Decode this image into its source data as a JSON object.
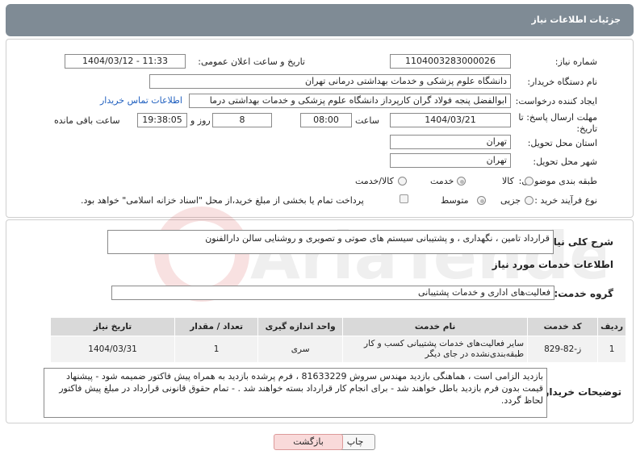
{
  "header": {
    "title": "جزئیات اطلاعات نیاز"
  },
  "form": {
    "need_number": {
      "label": "شماره نیاز:",
      "value": "1104003283000026"
    },
    "announce_datetime": {
      "label": "تاریخ و ساعت اعلان عمومی:",
      "value": "1404/03/12 - 11:33"
    },
    "buyer_org": {
      "label": "نام دستگاه خریدار:",
      "value": "دانشگاه علوم پزشکی و خدمات بهداشتی درمانی تهران"
    },
    "creator": {
      "label": "ایجاد کننده درخواست:",
      "value": "ابوالفضل  پنجه فولاد گران  کارپرداز دانشگاه علوم پزشکی و خدمات بهداشتی درما",
      "contact_link": "اطلاعات تماس خریدار"
    },
    "deadline": {
      "label": "مهلت ارسال پاسخ: تا تاریخ:",
      "date": "1404/03/21",
      "time_label": "ساعت",
      "time": "08:00",
      "days": "8",
      "days_label": "روز و",
      "remaining": "19:38:05",
      "remaining_label": "ساعت باقی مانده"
    },
    "province": {
      "label": "استان محل تحویل:",
      "value": "تهران"
    },
    "city": {
      "label": "شهر محل تحویل:",
      "value": "تهران"
    },
    "category": {
      "label": "طبقه بندی موضوعی:",
      "options": [
        "کالا",
        "خدمت",
        "کالا/خدمت"
      ],
      "selected": "خدمت"
    },
    "process": {
      "label": "نوع فرآیند خرید :",
      "options": [
        "جزیی",
        "متوسط"
      ],
      "selected": "متوسط",
      "note": "پرداخت تمام یا بخشی از مبلغ خرید،از محل \"اسناد خزانه اسلامی\" خواهد بود."
    }
  },
  "description": {
    "label": "شرح کلی نیاز:",
    "value": "قرارداد تامین ، نگهداری ، و پشتیبانی سیستم های صوتی و تصویری و روشنایی سالن دارالفنون"
  },
  "services": {
    "section_title": "اطلاعات خدمات مورد نیاز",
    "group_label": "گروه خدمت:",
    "group_value": "فعالیت‌های اداری و خدمات پشتیبانی",
    "columns": [
      "ردیف",
      "کد خدمت",
      "نام خدمت",
      "واحد اندازه گیری",
      "تعداد / مقدار",
      "تاریخ نیاز"
    ],
    "rows": [
      {
        "row": "1",
        "code": "ز-82-829",
        "name": "سایر فعالیت‌های خدمات پشتیبانی کسب و کار طبقه‌بندی‌نشده در جای دیگر",
        "unit": "سری",
        "qty": "1",
        "date": "1404/03/31"
      }
    ]
  },
  "buyer_notes": {
    "label": "توضیحات خریدار:",
    "value": "بازدید الزامی است ، هماهنگی بازدید مهندس سروش 81633229 ، فرم پرشده بازدید به همراه پیش فاکتور ضمیمه شود - پیشنهاد قیمت بدون فرم بازدید باطل خواهند شد - برای انجام کار قرارداد بسته خواهند شد . - تمام حقوق قانونی قرارداد در مبلغ پیش فاکتور لحاظ گردد."
  },
  "buttons": {
    "print": "چاپ",
    "back": "بازگشت"
  },
  "watermark": "AriaTender.neT"
}
